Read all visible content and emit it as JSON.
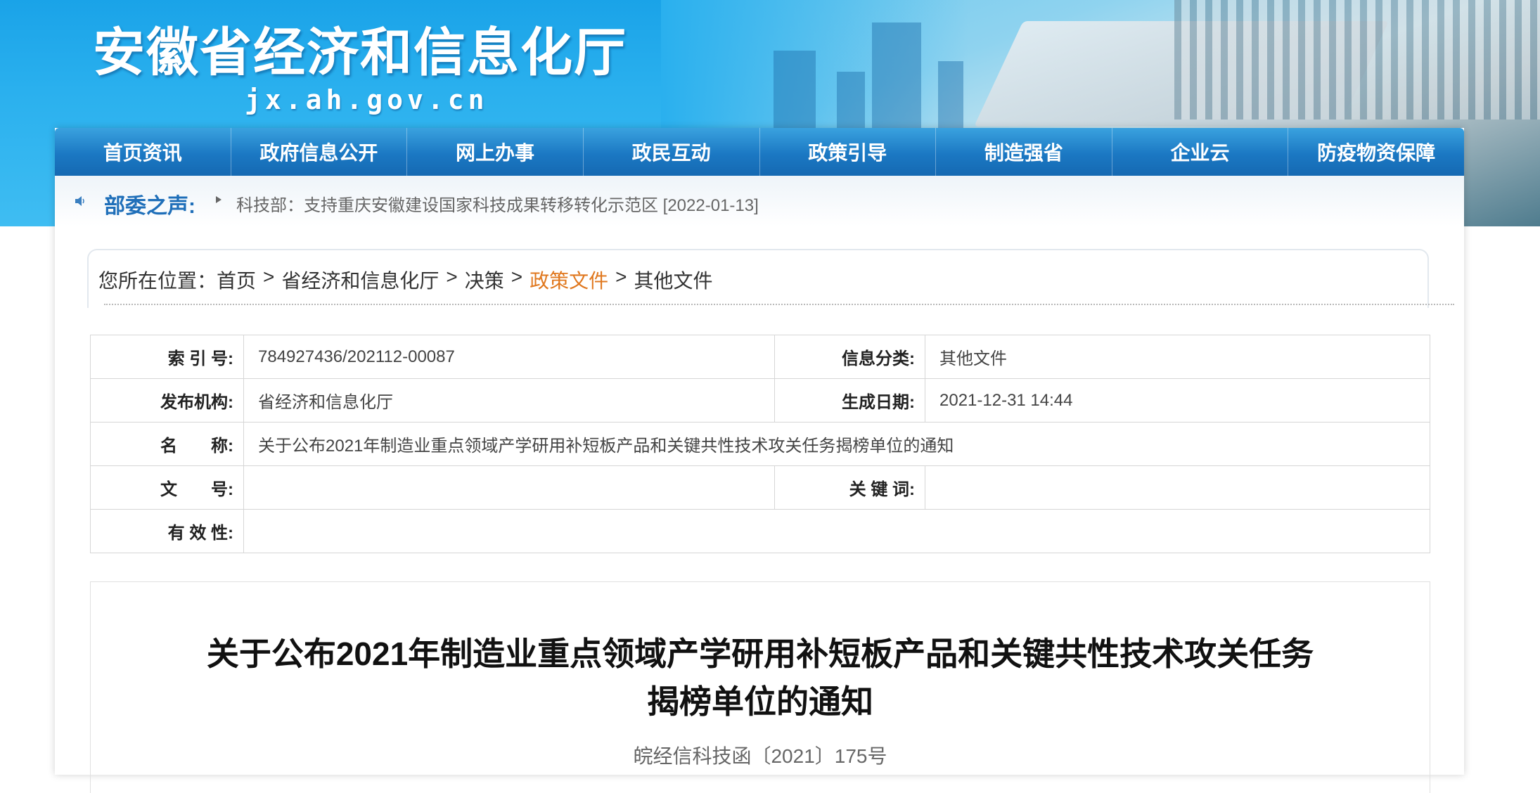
{
  "header": {
    "site_title": "安徽省经济和信息化厅",
    "site_domain": "jx.ah.gov.cn",
    "brand_color": "#1aa3e8"
  },
  "nav": {
    "items": [
      {
        "label": "首页资讯"
      },
      {
        "label": "政府信息公开"
      },
      {
        "label": "网上办事"
      },
      {
        "label": "政民互动"
      },
      {
        "label": "政策引导"
      },
      {
        "label": "制造强省"
      },
      {
        "label": "企业云"
      },
      {
        "label": "防疫物资保障"
      }
    ]
  },
  "notice": {
    "label": "部委之声:",
    "text": "科技部：支持重庆安徽建设国家科技成果转移转化示范区 [2022-01-13]"
  },
  "breadcrumb": {
    "prefix": "您所在位置：",
    "items": [
      "首页",
      "省经济和信息化厅",
      "决策",
      "政策文件",
      "其他文件"
    ],
    "separator": ">",
    "highlight_color": "#e0781f"
  },
  "info_table": {
    "index_label": "索 引 号:",
    "index_value": "784927436/202112-00087",
    "category_label": "信息分类:",
    "category_value": "其他文件",
    "publisher_label": "发布机构:",
    "publisher_value": "省经济和信息化厅",
    "date_label": "生成日期:",
    "date_value": "2021-12-31 14:44",
    "name_label": "名　　称:",
    "name_value": "关于公布2021年制造业重点领域产学研用补短板产品和关键共性技术攻关任务揭榜单位的通知",
    "docno_label": "文　　号:",
    "docno_value": "",
    "keywords_label": "关 键 词:",
    "keywords_value": "",
    "validity_label": "有 效 性:",
    "validity_value": ""
  },
  "article": {
    "title_line1": "关于公布2021年制造业重点领域产学研用补短板产品和关键共性技术攻关任务",
    "title_line2": "揭榜单位的通知",
    "doc_number": "皖经信科技函〔2021〕175号"
  }
}
